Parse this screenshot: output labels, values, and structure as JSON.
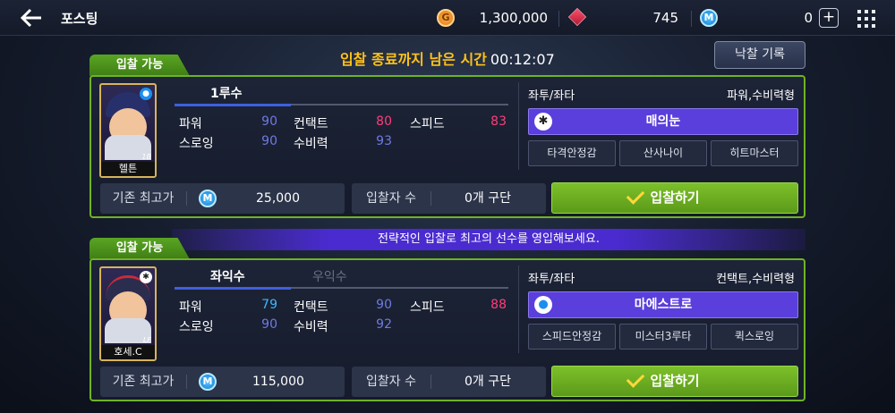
{
  "header": {
    "title": "포스팅",
    "gold_icon": "gold-coin-icon",
    "gold_letter": "G",
    "gold": "1,300,000",
    "gem_icon": "ruby-gem-icon",
    "gems": "745",
    "mileage_icon": "m-coin-icon",
    "mileage_letter": "M",
    "mileage": "0",
    "plus_label": "+"
  },
  "history_button": "낙찰 기록",
  "timer": {
    "label": "입찰 종료까지 남은 시간",
    "time": "00:12:07"
  },
  "banner": "전략적인 입찰로 최고의 선수를 영입해보세요.",
  "cards": [
    {
      "tag": "입찰 가능",
      "player_name": "헬튼",
      "position_code": "1B",
      "badge": "●",
      "tabs": [
        "1루수"
      ],
      "stats": {
        "power_label": "파워",
        "power": "90",
        "contact_label": "컨택트",
        "contact": "80",
        "speed_label": "스피드",
        "speed": "83",
        "throw_label": "스로잉",
        "throw": "90",
        "defense_label": "수비력",
        "defense": "93"
      },
      "hand": "좌투/좌타",
      "type": "파워,수비력형",
      "skill_main": "매의눈",
      "skill_main_icon": "✱",
      "skills": [
        "타격안정감",
        "산사나이",
        "히트마스터"
      ],
      "highest_label": "기존 최고가",
      "highest_letter": "M",
      "highest_value": "25,000",
      "bidders_label": "입찰자 수",
      "bidders_value": "0개 구단",
      "bid_label": "입찰하기"
    },
    {
      "tag": "입찰 가능",
      "player_name": "호세.C",
      "position_code": "LF",
      "badge": "✱",
      "tabs": [
        "좌익수",
        "우익수"
      ],
      "stats": {
        "power_label": "파워",
        "power": "79",
        "contact_label": "컨택트",
        "contact": "90",
        "speed_label": "스피드",
        "speed": "88",
        "throw_label": "스로잉",
        "throw": "90",
        "defense_label": "수비력",
        "defense": "92"
      },
      "hand": "좌투/좌타",
      "type": "컨택트,수비력형",
      "skill_main": "마에스트로",
      "skill_main_icon": "●",
      "skills": [
        "스피드안정감",
        "미스터3루타",
        "퀵스로잉"
      ],
      "highest_label": "기존 최고가",
      "highest_letter": "M",
      "highest_value": "115,000",
      "bidders_label": "입찰자 수",
      "bidders_value": "0개 구단",
      "bid_label": "입찰하기"
    }
  ]
}
